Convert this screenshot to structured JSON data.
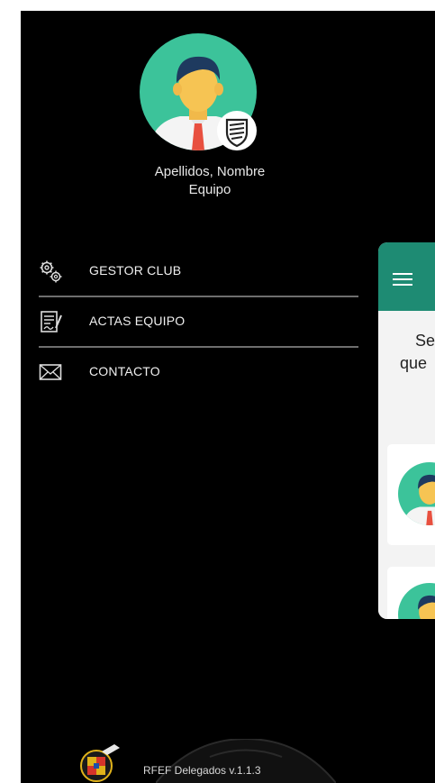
{
  "profile": {
    "name": "Apellidos, Nombre",
    "team": "Equipo"
  },
  "menu": {
    "items": [
      {
        "label": "GESTOR CLUB",
        "icon": "gears-icon"
      },
      {
        "label": "ACTAS EQUIPO",
        "icon": "document-signature-icon"
      },
      {
        "label": "CONTACTO",
        "icon": "envelope-icon"
      }
    ]
  },
  "card": {
    "line1": "Se",
    "line2": "que"
  },
  "footer": {
    "version": "RFEF Delegados v.1.1.3"
  },
  "colors": {
    "background": "#000000",
    "accent": "#1e8b73",
    "avatar_bg": "#3cc39a"
  }
}
